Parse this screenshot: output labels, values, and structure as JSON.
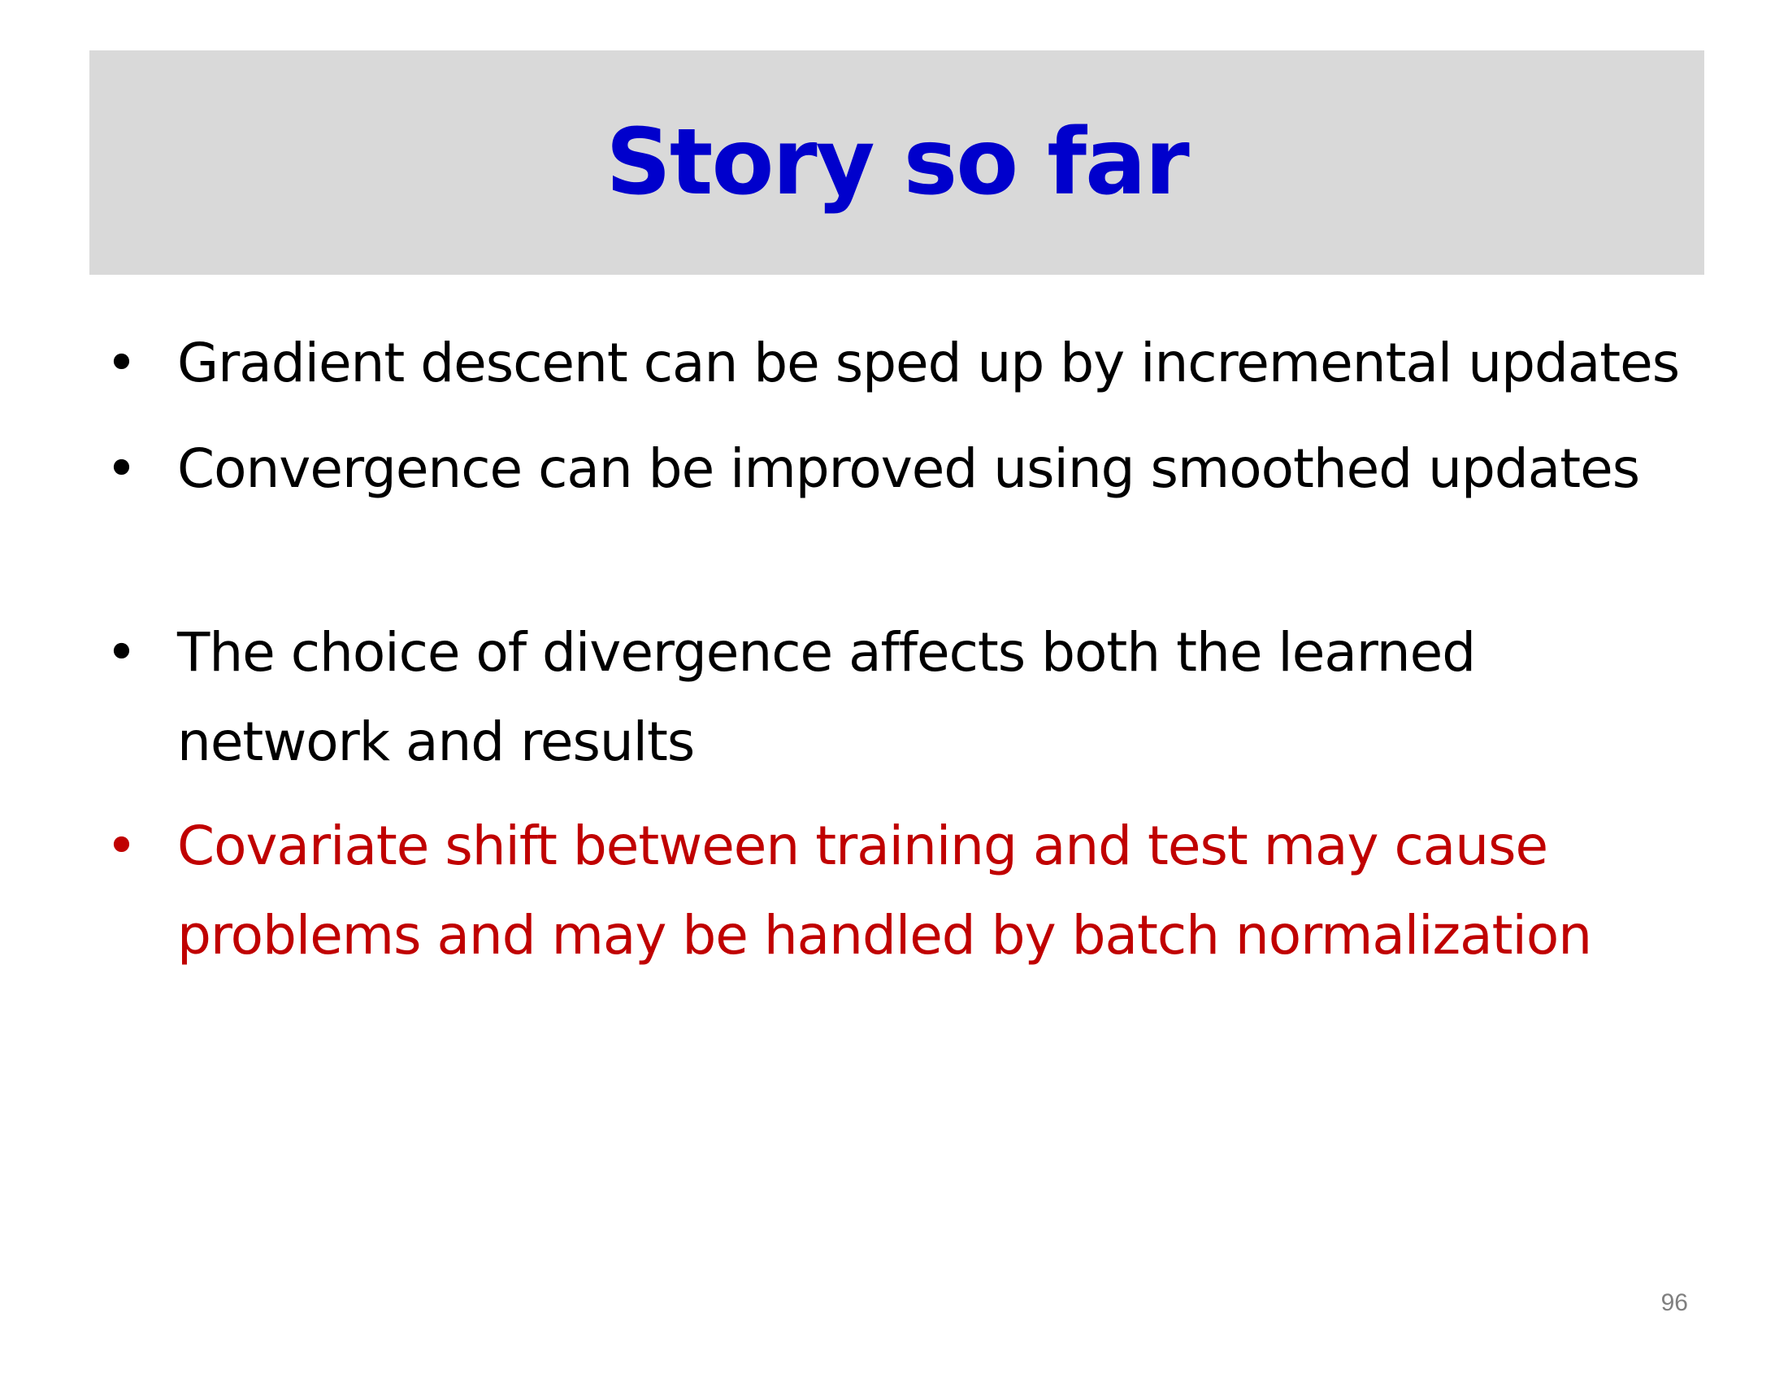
{
  "slide": {
    "title": "Story so far",
    "bullet_glyph": "•",
    "bullets": [
      {
        "text": "Gradient descent can be sped up by incremental updates"
      },
      {
        "text": "Convergence can be improved using smoothed updates"
      },
      {
        "text": "The choice of divergence affects both the learned network and results"
      },
      {
        "text": "Covariate shift between training and test may cause problems and may be handled by batch normalization"
      }
    ],
    "page_number": "96"
  },
  "colors": {
    "title": "#0000cc",
    "title_bar_background": "#d9d9d9",
    "body_text": "#000000",
    "highlight_text": "#c00000",
    "page_number": "#7f7f7f"
  }
}
